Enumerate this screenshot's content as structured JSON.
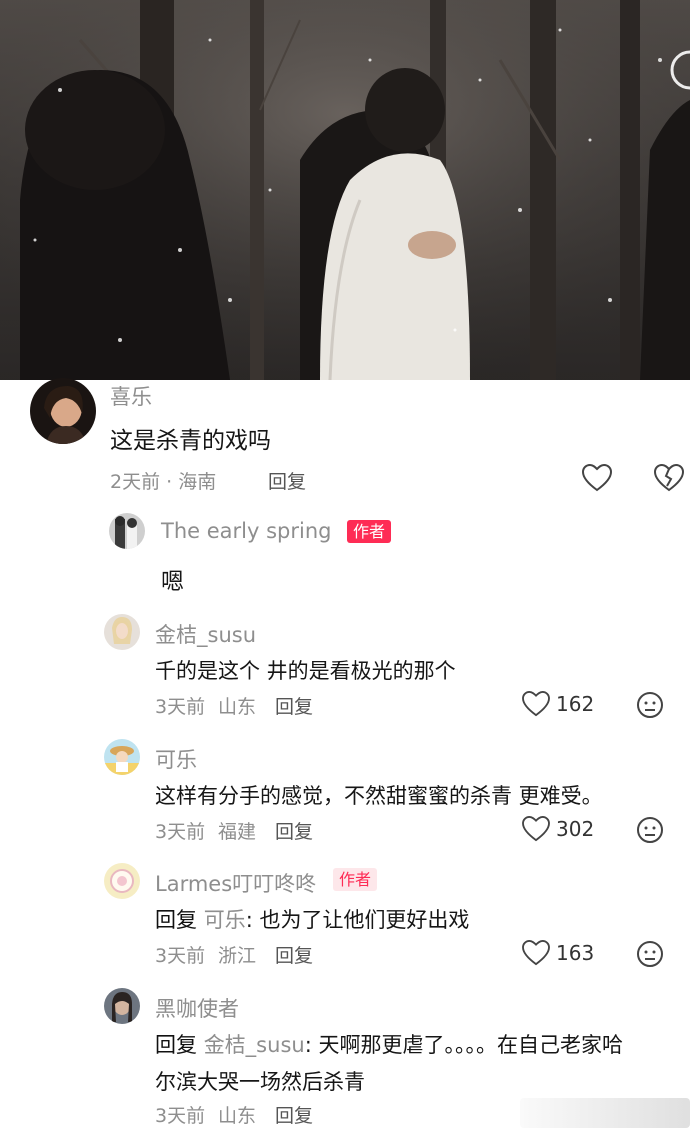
{
  "colors": {
    "accent": "#fe2c55",
    "muted": "#8e8e8e",
    "text": "#161616"
  },
  "video": {
    "description_icon": "video-still"
  },
  "comment_main": {
    "username": "喜乐",
    "text": "这是杀青的戏吗",
    "time_location": "2天前 · 海南",
    "reply_label": "回复"
  },
  "replies": [
    {
      "username": "The early spring",
      "badge": "作者",
      "text": "嗯"
    },
    {
      "username": "金桔_susu",
      "text": "千的是这个 井的是看极光的那个",
      "time": "3天前",
      "location": "山东",
      "reply_label": "回复",
      "likes": "162"
    },
    {
      "username": "可乐",
      "text": "这样有分手的感觉，不然甜蜜蜜的杀青 更难受。",
      "time": "3天前",
      "location": "福建",
      "reply_label": "回复",
      "likes": "302"
    },
    {
      "username": "Larmes叮叮咚咚",
      "badge": "作者",
      "reply_prefix": "回复",
      "reply_target": "可乐",
      "text": ": 也为了让他们更好出戏",
      "time": "3天前",
      "location": "浙江",
      "reply_label": "回复",
      "likes": "163"
    },
    {
      "username": "黑咖使者",
      "reply_prefix": "回复",
      "reply_target": "金桔_susu",
      "text_line1": ": 天啊那更虐了。。。。在自己老家哈",
      "text_line2": "尔滨大哭一场然后杀青",
      "time": "3天前",
      "location": "山东",
      "reply_label": "回复"
    }
  ]
}
